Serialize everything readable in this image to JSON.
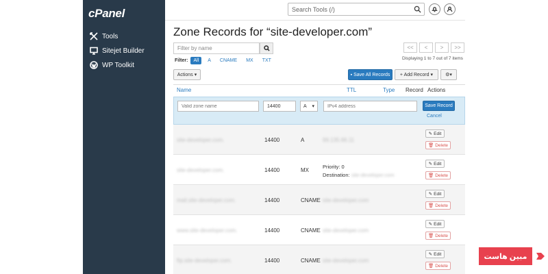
{
  "sidebar": {
    "logo": "cPanel",
    "items": [
      {
        "label": "Tools",
        "icon": "tools-icon"
      },
      {
        "label": "Sitejet Builder",
        "icon": "monitor-icon"
      },
      {
        "label": "WP Toolkit",
        "icon": "wordpress-icon"
      }
    ]
  },
  "topbar": {
    "search_placeholder": "Search Tools (/)"
  },
  "page": {
    "title": "Zone Records for “site-developer.com”",
    "filter_placeholder": "Filter by name",
    "filter_label": "Filter:",
    "filter_chips": [
      "All",
      "A",
      "CNAME",
      "MX",
      "TXT"
    ],
    "pager": [
      "<<",
      "<",
      ">",
      ">>"
    ],
    "displaying": "Displaying 1 to 7 out of 7 items",
    "actions_label": "Actions",
    "save_all_label": "Save All Records",
    "add_record_label": "+ Add Record"
  },
  "table": {
    "headers": {
      "name": "Name",
      "ttl": "TTL",
      "type": "Type",
      "record": "Record",
      "actions": "Actions"
    },
    "new_row": {
      "name_placeholder": "Valid zone name",
      "ttl_value": "14400",
      "type_value": "A",
      "record_placeholder": "IPv4 address",
      "save_label": "Save Record",
      "cancel_label": "Cancel"
    },
    "edit_label": "Edit",
    "delete_label": "Delete",
    "rows": [
      {
        "name": "site-developer.com.",
        "ttl": "14400",
        "type": "A",
        "record": "99.135.66.11"
      },
      {
        "name": "site-developer.com.",
        "ttl": "14400",
        "type": "MX",
        "priority_label": "Priority:",
        "priority": "0",
        "destination_label": "Destination:",
        "destination": "site-developer.com"
      },
      {
        "name": "mail.site-developer.com.",
        "ttl": "14400",
        "type": "CNAME",
        "record": "site-developer.com"
      },
      {
        "name": "www.site-developer.com.",
        "ttl": "14400",
        "type": "CNAME",
        "record": "site-developer.com"
      },
      {
        "name": "ftp.site-developer.com.",
        "ttl": "14400",
        "type": "CNAME",
        "record": "site-developer.com"
      }
    ]
  },
  "brand": {
    "text": "مبین هاست",
    "color": "#e8414e"
  }
}
